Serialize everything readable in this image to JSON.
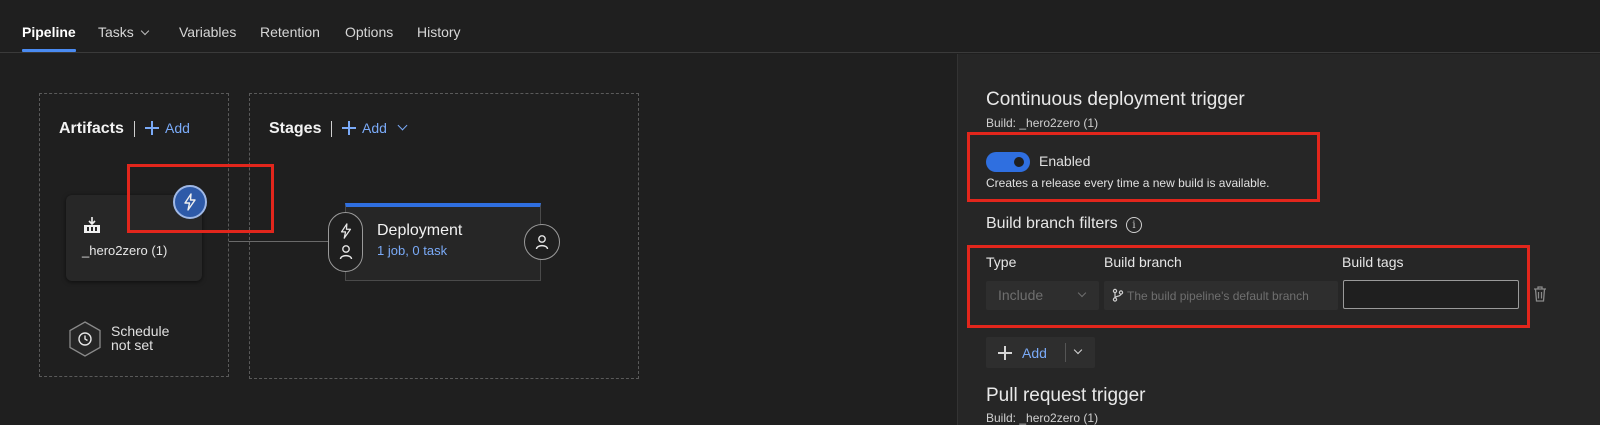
{
  "nav": {
    "tabs": [
      {
        "label": "Pipeline"
      },
      {
        "label": "Tasks"
      },
      {
        "label": "Variables"
      },
      {
        "label": "Retention"
      },
      {
        "label": "Options"
      },
      {
        "label": "History"
      }
    ]
  },
  "artifacts": {
    "title": "Artifacts",
    "add_label": "Add",
    "artifact_name": "_hero2zero (1)",
    "schedule_line1": "Schedule",
    "schedule_line2": "not set"
  },
  "stages": {
    "title": "Stages",
    "add_label": "Add",
    "stage": {
      "name": "Deployment",
      "summary": "1 job, 0 task"
    }
  },
  "panel": {
    "title": "Continuous deployment trigger",
    "build_line": "Build: _hero2zero (1)",
    "toggle_label": "Enabled",
    "toggle_on": true,
    "toggle_description": "Creates a release every time a new build is available.",
    "filters_title": "Build branch filters",
    "columns": {
      "type": "Type",
      "branch": "Build branch",
      "tags": "Build tags"
    },
    "filter_row": {
      "type_value": "Include",
      "branch_placeholder": "The build pipeline's default branch",
      "tags_value": ""
    },
    "add_label": "Add",
    "pr_title": "Pull request trigger",
    "pr_build_line": "Build: _hero2zero (1)"
  },
  "colors": {
    "accent": "#2f6fe0",
    "link": "#7aaaf7",
    "highlight": "#e2261c"
  }
}
